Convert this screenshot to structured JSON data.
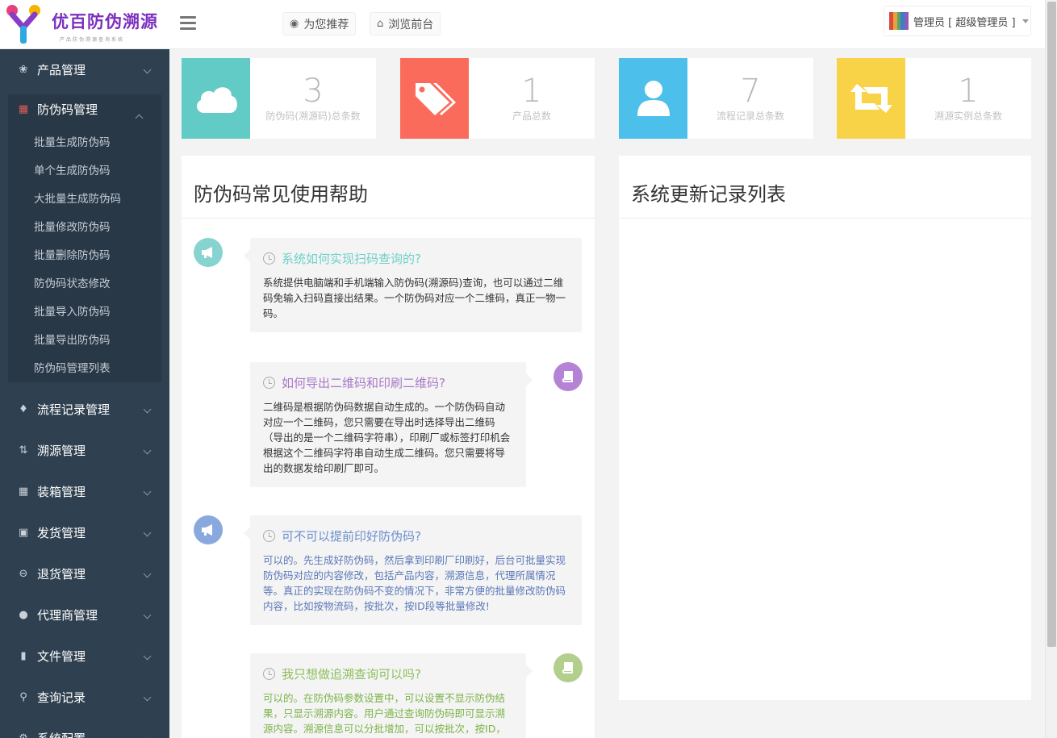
{
  "header": {
    "logo_text": "优百防伪溯源",
    "logo_sub": "产品防伪溯源查询系统",
    "btn_recommend": "为您推荐",
    "btn_browse": "浏览前台",
    "user_label": "管理员 [ 超级管理员 ]"
  },
  "sidebar": {
    "items": [
      {
        "label": "产品管理",
        "icon": "leaf-icon"
      },
      {
        "label": "防伪码管理",
        "icon": "qrcode-icon"
      },
      {
        "label": "流程记录管理",
        "icon": "tags-icon"
      },
      {
        "label": "溯源管理",
        "icon": "retweet-icon"
      },
      {
        "label": "装箱管理",
        "icon": "th-icon"
      },
      {
        "label": "发货管理",
        "icon": "truck-icon"
      },
      {
        "label": "退货管理",
        "icon": "minus-circle-icon"
      },
      {
        "label": "代理商管理",
        "icon": "users-icon"
      },
      {
        "label": "文件管理",
        "icon": "file-icon"
      },
      {
        "label": "查询记录",
        "icon": "search-icon"
      },
      {
        "label": "系统配置",
        "icon": "gear-icon"
      }
    ],
    "sub_items": [
      "批量生成防伪码",
      "单个生成防伪码",
      "大批量生成防伪码",
      "批量修改防伪码",
      "批量删除防伪码",
      "防伪码状态修改",
      "批量导入防伪码",
      "批量导出防伪码",
      "防伪码管理列表"
    ]
  },
  "stats": [
    {
      "value": "3",
      "label": "防伪码(溯源码)总条数",
      "color": "#62cbc6",
      "icon": "cloud-icon"
    },
    {
      "value": "1",
      "label": "产品总数",
      "color": "#fb6b5b",
      "icon": "tags-icon"
    },
    {
      "value": "7",
      "label": "流程记录总条数",
      "color": "#4cc0ea",
      "icon": "user-icon"
    },
    {
      "value": "1",
      "label": "溯源实例总条数",
      "color": "#f8d247",
      "icon": "retweet-icon"
    }
  ],
  "help_panel": {
    "title": "防伪码常见使用帮助",
    "faqs": [
      {
        "q": "系统如何实现扫码查询的?",
        "a": "系统提供电脑端和手机端输入防伪码(溯源码)查询，也可以通过二维码免输入扫码直接出结果。一个防伪码对应一个二维码，真正一物一码。",
        "q_color": "#6fd1c8",
        "a_color": "#333333",
        "badge_color": "#86d3d0",
        "icon": "bullhorn-icon"
      },
      {
        "q": "如何导出二维码和印刷二维码?",
        "a": "二维码是根据防伪码数据自动生成的。一个防伪码自动对应一个二维码，您只需要在导出时选择导出二维码（导出的是一个二维码字符串），印刷厂或标签打印机会根据这个二维码字符串自动生成二维码。您只需要将导出的数据发给印刷厂即可。",
        "q_color": "#a779c8",
        "a_color": "#333333",
        "badge_color": "#b583d6",
        "icon": "book-icon"
      },
      {
        "q": "可不可以提前印好防伪码?",
        "a": "可以的。先生成好防伪码，然后拿到印刷厂印刷好，后台可批量实现防伪码对应的内容修改，包括产品内容，溯源信息，代理所属情况等。真正的实现在防伪码不变的情况下，非常方便的批量修改防伪码内容，比如按物流码，按批次，按ID段等批量修改!",
        "q_color": "#6b8fce",
        "a_color": "#5a78b8",
        "badge_color": "#89a9de",
        "icon": "bullhorn-icon"
      },
      {
        "q": "我只想做追溯查询可以吗?",
        "a": "可以的。在防伪码参数设置中，可以设置不显示防伪结果，只显示溯源内容。用户通过查询防伪码即可显示溯源内容。溯源信息可以分批增加，可以按批次，按ID，按产品等等批量修改。",
        "q_color": "#8dbf5e",
        "a_color": "#7cb34a",
        "badge_color": "#b2cf8c",
        "icon": "book-icon"
      }
    ]
  },
  "update_panel": {
    "title": "系统更新记录列表"
  }
}
